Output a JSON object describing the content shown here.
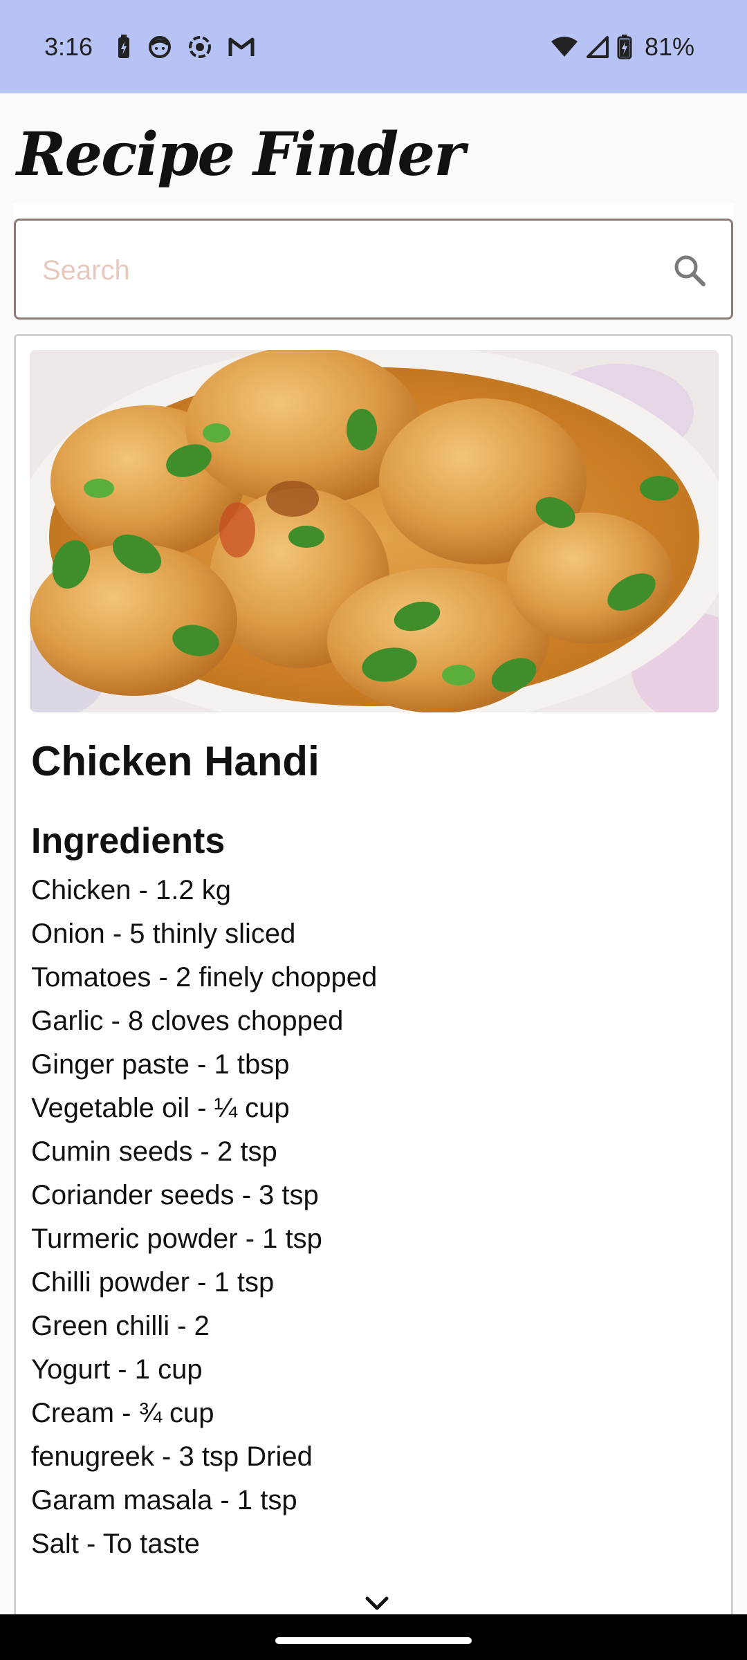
{
  "status_bar": {
    "time": "3:16",
    "left_icons": [
      "battery-saver-icon",
      "notification-face-icon",
      "screen-record-icon",
      "gmail-icon"
    ],
    "right_icons": [
      "wifi-icon",
      "cell-signal-icon",
      "battery-charging-icon"
    ],
    "battery": "81%"
  },
  "header": {
    "title": "Recipe Finder"
  },
  "search": {
    "placeholder": "Search",
    "value": ""
  },
  "recipe": {
    "title": "Chicken Handi",
    "ingredients_heading": "Ingredients",
    "ingredients": [
      "Chicken - 1.2 kg",
      "Onion - 5 thinly sliced",
      "Tomatoes - 2 finely chopped",
      "Garlic - 8 cloves chopped",
      "Ginger paste - 1 tbsp",
      "Vegetable oil - ¼ cup",
      "Cumin seeds - 2 tsp",
      "Coriander seeds - 3 tsp",
      "Turmeric powder - 1 tsp",
      "Chilli powder - 1 tsp",
      "Green chilli - 2",
      "Yogurt - 1 cup",
      "Cream - ¾ cup",
      "fenugreek - 3 tsp Dried",
      "Garam masala - 1 tsp",
      "Salt - To taste"
    ]
  },
  "colors": {
    "status_bar": "#b6c3f4",
    "search_border": "#8b7b74",
    "placeholder": "#e7c8bf"
  }
}
